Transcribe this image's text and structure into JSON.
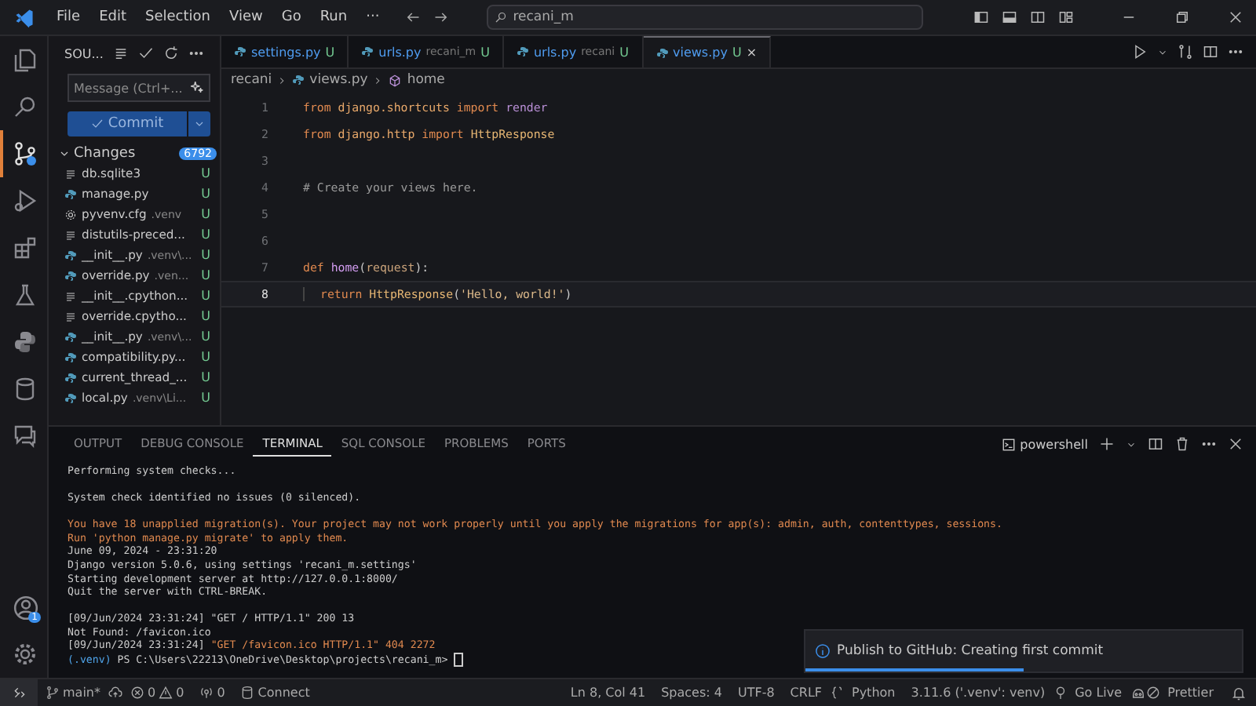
{
  "window": {
    "menu": [
      "File",
      "Edit",
      "Selection",
      "View",
      "Go",
      "Run",
      "···"
    ],
    "search": "recani_m"
  },
  "activity_bar": [
    {
      "kind": "files",
      "selected": false
    },
    {
      "kind": "search",
      "selected": false
    },
    {
      "kind": "source-control",
      "selected": true
    },
    {
      "kind": "run",
      "selected": false
    },
    {
      "kind": "extensions",
      "selected": false
    },
    {
      "kind": "testing",
      "selected": false
    },
    {
      "kind": "python",
      "selected": false
    },
    {
      "kind": "database",
      "selected": false
    },
    {
      "kind": "remote",
      "selected": false
    }
  ],
  "account_badge": "1",
  "sidebar": {
    "title": "SOU...",
    "message": {
      "placeholder": "Message (Ctrl+..."
    },
    "commit": "Commit",
    "changes": {
      "label": "Changes",
      "count": "6792",
      "expanded": true
    },
    "files": [
      {
        "name": "db.sqlite3",
        "kind": "text",
        "status": "U"
      },
      {
        "name": "manage.py",
        "kind": "python",
        "status": "U"
      },
      {
        "name": "pyvenv.cfg",
        "hint": ".venv",
        "kind": "config",
        "status": "U"
      },
      {
        "name": "distutils-preced...",
        "kind": "text",
        "status": "U"
      },
      {
        "name": "__init__.py",
        "hint": ".venv\\...",
        "kind": "python",
        "status": "U"
      },
      {
        "name": "override.py",
        "hint": ".ven...",
        "kind": "python",
        "status": "U"
      },
      {
        "name": "__init__.cpython...",
        "kind": "text",
        "status": "U"
      },
      {
        "name": "override.cpytho...",
        "kind": "text",
        "status": "U"
      },
      {
        "name": "__init__.py",
        "hint": ".venv\\...",
        "kind": "python",
        "status": "U"
      },
      {
        "name": "compatibility.py...",
        "kind": "python",
        "status": "U"
      },
      {
        "name": "current_thread_...",
        "kind": "python",
        "status": "U"
      },
      {
        "name": "local.py",
        "hint": ".venv\\Li...",
        "kind": "python",
        "status": "U"
      }
    ]
  },
  "tabs": [
    {
      "label": "settings.py",
      "status": "U",
      "selected": false
    },
    {
      "label": "urls.py",
      "hint": "recani_m",
      "status": "U",
      "selected": false
    },
    {
      "label": "urls.py",
      "hint": "recani",
      "status": "U",
      "selected": false
    },
    {
      "label": "views.py",
      "status": "U",
      "selected": true,
      "close": "×"
    }
  ],
  "breadcrumb": [
    "recani",
    "views.py",
    "home"
  ],
  "code": [
    {
      "number": "1",
      "tokens": [
        {
          "t": "from ",
          "kind": "keyword"
        },
        {
          "t": "django.shortcuts ",
          "kind": "module"
        },
        {
          "t": "import ",
          "kind": "keyword"
        },
        {
          "t": "render",
          "kind": "name"
        }
      ]
    },
    {
      "number": "2",
      "tokens": [
        {
          "t": "from ",
          "kind": "keyword"
        },
        {
          "t": "django.http ",
          "kind": "module"
        },
        {
          "t": "import ",
          "kind": "keyword"
        },
        {
          "t": "HttpResponse",
          "kind": "class"
        }
      ]
    },
    {
      "number": "3"
    },
    {
      "number": "4",
      "tokens": [
        {
          "t": "# Create your views here.",
          "kind": "comment"
        }
      ]
    },
    {
      "number": "5"
    },
    {
      "number": "6"
    },
    {
      "number": "7",
      "tokens": [
        {
          "t": "def ",
          "kind": "keyword"
        },
        {
          "t": "home",
          "kind": "func"
        },
        {
          "t": "(",
          "kind": "plain"
        },
        {
          "t": "request",
          "kind": "param"
        },
        {
          "t": "):",
          "kind": "plain"
        }
      ]
    },
    {
      "number": "8",
      "current": true,
      "indent": true,
      "tokens": [
        {
          "t": "return ",
          "kind": "keyword"
        },
        {
          "t": "HttpResponse",
          "kind": "class"
        },
        {
          "t": "(",
          "kind": "plain"
        },
        {
          "t": "'Hello, world!'",
          "kind": "string"
        },
        {
          "t": ")",
          "kind": "plain"
        }
      ]
    }
  ],
  "panel": {
    "tabs": [
      {
        "label": "OUTPUT",
        "selected": false
      },
      {
        "label": "DEBUG CONSOLE",
        "selected": false
      },
      {
        "label": "TERMINAL",
        "selected": true
      },
      {
        "label": "SQL CONSOLE",
        "selected": false
      },
      {
        "label": "PROBLEMS",
        "selected": false
      },
      {
        "label": "PORTS",
        "selected": false
      }
    ],
    "shell": "powershell",
    "terminal": [
      [
        [
          {
            "t": "Performing system checks...",
            "kind": "normal"
          }
        ]
      ],
      [
        [
          {
            "t": "System check identified no issues (0 silenced).",
            "kind": "normal"
          }
        ]
      ],
      [
        [
          {
            "t": "You have 18 unapplied migration(s). Your project may not work properly until you apply the migrations for app(s): admin, auth, contenttypes, sessions.",
            "kind": "warning"
          }
        ],
        [
          {
            "t": "Run 'python manage.py migrate' to apply them.",
            "kind": "warning"
          }
        ],
        [
          {
            "t": "June 09, 2024 - 23:31:20",
            "kind": "normal"
          }
        ],
        [
          {
            "t": "Django version 5.0.6, using settings 'recani_m.settings'",
            "kind": "normal"
          }
        ],
        [
          {
            "t": "Starting development server at http://127.0.0.1:8000/",
            "kind": "normal"
          }
        ],
        [
          {
            "t": "Quit the server with CTRL-BREAK.",
            "kind": "normal"
          }
        ]
      ],
      [
        [
          {
            "t": "[09/Jun/2024 23:31:24] \"GET / HTTP/1.1\" 200 13",
            "kind": "normal"
          }
        ],
        [
          {
            "t": "Not Found: /favicon.ico",
            "kind": "normal"
          }
        ],
        [
          {
            "t": "[09/Jun/2024 23:31:24] ",
            "kind": "normal"
          },
          {
            "t": "\"GET /favicon.ico HTTP/1.1\" 404 2272",
            "kind": "warning"
          }
        ],
        [
          {
            "t": "(.venv)",
            "kind": "env"
          },
          {
            "t": " PS C:\\Users\\22213\\OneDrive\\Desktop\\projects\\recani_m> ",
            "kind": "normal"
          }
        ]
      ]
    ]
  },
  "notification": {
    "text": "Publish to GitHub: Creating first commit",
    "level": 0.5
  },
  "status_bar": {
    "branch": "main*",
    "errors": "0",
    "warnings": "0",
    "ports": "0",
    "connect": "Connect",
    "right": [
      "Ln 8, Col 41",
      "Spaces: 4",
      "UTF-8",
      "CRLF",
      "Python",
      "3.11.6 ('.venv': venv)",
      "Go Live",
      "Prettier"
    ]
  }
}
